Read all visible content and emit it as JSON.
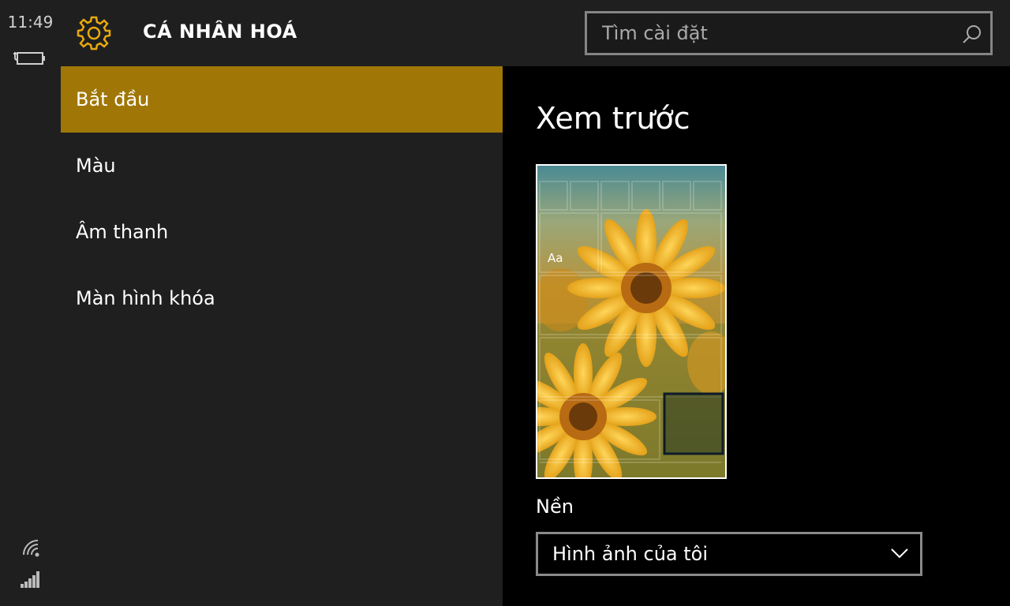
{
  "status": {
    "time": "11:49",
    "battery_icon": "battery-charging-icon",
    "wifi_icon": "wifi-icon",
    "signal_icon": "cellular-signal-icon"
  },
  "header": {
    "icon": "gear-icon",
    "title": "CÁ NHÂN HOÁ",
    "search_placeholder": "Tìm cài đặt",
    "search_icon": "search-icon"
  },
  "nav": {
    "items": [
      {
        "label": "Bắt đầu",
        "active": true
      },
      {
        "label": "Màu",
        "active": false
      },
      {
        "label": "Âm thanh",
        "active": false
      },
      {
        "label": "Màn hình khóa",
        "active": false
      }
    ]
  },
  "content": {
    "heading": "Xem trước",
    "preview_text": "Aa",
    "background_label": "Nền",
    "background_value": "Hình ảnh của tôi"
  },
  "colors": {
    "accent": "#a07706",
    "chrome": "#1f1f1f",
    "content_bg": "#000000"
  }
}
